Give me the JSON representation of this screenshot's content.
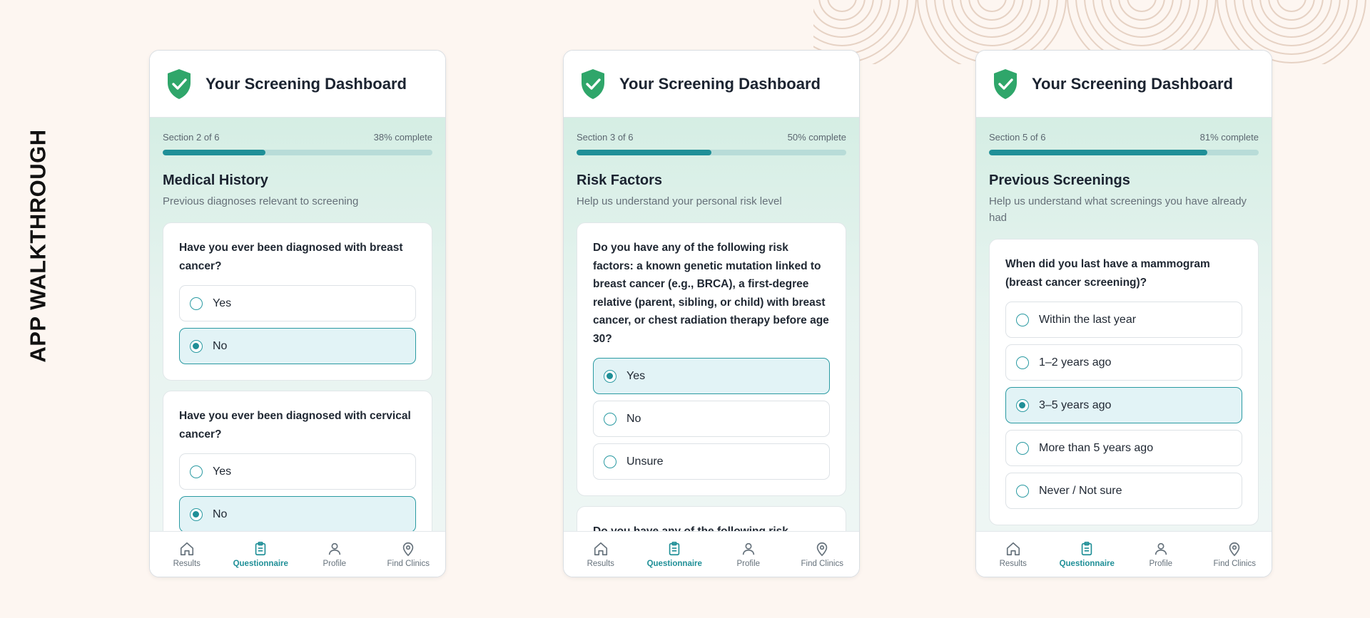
{
  "side_title": "APP WALKTHROUGH",
  "colors": {
    "accent": "#1f8f97",
    "shield": "#2fa66a",
    "background": "#fdf6f1"
  },
  "screens": [
    {
      "app_title": "Your Screening Dashboard",
      "section_label": "Section 2 of 6",
      "progress_label": "38% complete",
      "progress": 38,
      "section_title": "Medical History",
      "section_subtitle": "Previous diagnoses relevant to screening",
      "questions": [
        {
          "text": "Have you ever been diagnosed with breast cancer?",
          "options": [
            {
              "label": "Yes",
              "selected": false
            },
            {
              "label": "No",
              "selected": true
            }
          ]
        },
        {
          "text": "Have you ever been diagnosed with cervical cancer?",
          "options": [
            {
              "label": "Yes",
              "selected": false
            },
            {
              "label": "No",
              "selected": true
            }
          ]
        }
      ],
      "nav": [
        {
          "label": "Results",
          "icon": "home-icon",
          "active": false
        },
        {
          "label": "Questionnaire",
          "icon": "clipboard-icon",
          "active": true
        },
        {
          "label": "Profile",
          "icon": "user-icon",
          "active": false
        },
        {
          "label": "Find Clinics",
          "icon": "map-pin-icon",
          "active": false
        }
      ]
    },
    {
      "app_title": "Your Screening Dashboard",
      "section_label": "Section 3 of 6",
      "progress_label": "50% complete",
      "progress": 50,
      "section_title": "Risk Factors",
      "section_subtitle": "Help us understand your personal risk level",
      "questions": [
        {
          "text": "Do you have any of the following risk factors: a known genetic mutation linked to breast cancer (e.g., BRCA), a first-degree relative (parent, sibling, or child) with breast cancer, or chest radiation therapy before age 30?",
          "options": [
            {
              "label": "Yes",
              "selected": true
            },
            {
              "label": "No",
              "selected": false
            },
            {
              "label": "Unsure",
              "selected": false
            }
          ]
        },
        {
          "text": "Do you have any of the following risk",
          "options": []
        }
      ],
      "nav": [
        {
          "label": "Results",
          "icon": "home-icon",
          "active": false
        },
        {
          "label": "Questionnaire",
          "icon": "clipboard-icon",
          "active": true
        },
        {
          "label": "Profile",
          "icon": "user-icon",
          "active": false
        },
        {
          "label": "Find Clinics",
          "icon": "map-pin-icon",
          "active": false
        }
      ]
    },
    {
      "app_title": "Your Screening Dashboard",
      "section_label": "Section 5 of 6",
      "progress_label": "81% complete",
      "progress": 81,
      "section_title": "Previous Screenings",
      "section_subtitle": "Help us understand what screenings you have already had",
      "questions": [
        {
          "text": "When did you last have a mammogram (breast cancer screening)?",
          "options": [
            {
              "label": "Within the last year",
              "selected": false
            },
            {
              "label": "1–2 years ago",
              "selected": false
            },
            {
              "label": "3–5 years ago",
              "selected": true
            },
            {
              "label": "More than 5 years ago",
              "selected": false
            },
            {
              "label": "Never / Not sure",
              "selected": false
            }
          ]
        }
      ],
      "nav": [
        {
          "label": "Results",
          "icon": "home-icon",
          "active": false
        },
        {
          "label": "Questionnaire",
          "icon": "clipboard-icon",
          "active": true
        },
        {
          "label": "Profile",
          "icon": "user-icon",
          "active": false
        },
        {
          "label": "Find Clinics",
          "icon": "map-pin-icon",
          "active": false
        }
      ]
    }
  ]
}
